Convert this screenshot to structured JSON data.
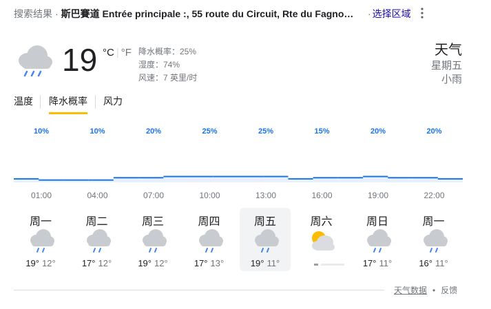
{
  "header": {
    "crumb_label": "搜索结果",
    "separator": "·",
    "location": "斯巴賽道 Entrée principale :, 55 route du Circuit, Rte du Fagno…",
    "choose_region": "选择区域"
  },
  "current": {
    "temperature": "19",
    "unit_c": "°C",
    "unit_f": "°F",
    "precip": "降水概率：25%",
    "humidity": "湿度：74%",
    "wind": "风速：7 英里/时",
    "icon": "rain-cloud-icon"
  },
  "summary": {
    "title": "天气",
    "day": "星期五",
    "condition": "小雨"
  },
  "tabs": [
    {
      "label": "温度",
      "active": false
    },
    {
      "label": "降水概率",
      "active": true
    },
    {
      "label": "风力",
      "active": false
    }
  ],
  "chart_data": {
    "type": "bar",
    "categories": [
      "01:00",
      "04:00",
      "07:00",
      "10:00",
      "13:00",
      "16:00",
      "19:00",
      "22:00"
    ],
    "values": [
      10,
      10,
      20,
      25,
      25,
      15,
      20,
      20
    ],
    "value_labels": [
      "10%",
      "10%",
      "20%",
      "25%",
      "25%",
      "15%",
      "20%",
      "20%"
    ],
    "hourly_values": [
      15,
      10,
      10,
      10,
      20,
      20,
      25,
      25,
      25,
      25,
      25,
      15,
      20,
      20,
      25,
      20,
      20,
      15
    ],
    "ylim": [
      0,
      100
    ],
    "color": "#1a73e8",
    "fill_color": "#e8f0fe"
  },
  "days": [
    {
      "name": "周一",
      "hi": "19°",
      "lo": "12°",
      "icon": "rain-cloud-icon",
      "selected": false
    },
    {
      "name": "周二",
      "hi": "17°",
      "lo": "12°",
      "icon": "rain-cloud-icon",
      "selected": false
    },
    {
      "name": "周三",
      "hi": "19°",
      "lo": "12°",
      "icon": "rain-cloud-icon",
      "selected": false
    },
    {
      "name": "周四",
      "hi": "17°",
      "lo": "13°",
      "icon": "rain-cloud-icon",
      "selected": false
    },
    {
      "name": "周五",
      "hi": "19°",
      "lo": "11°",
      "icon": "rain-cloud-icon",
      "selected": true
    },
    {
      "name": "周六",
      "hi": "",
      "lo": "",
      "icon": "partly-sunny-icon",
      "selected": false
    },
    {
      "name": "周日",
      "hi": "17°",
      "lo": "11°",
      "icon": "rain-cloud-icon",
      "selected": false
    },
    {
      "name": "周一",
      "hi": "16°",
      "lo": "11°",
      "icon": "rain-cloud-icon",
      "selected": false
    }
  ],
  "footer": {
    "source": "天气数据",
    "bullet": "•",
    "feedback": "反馈"
  }
}
